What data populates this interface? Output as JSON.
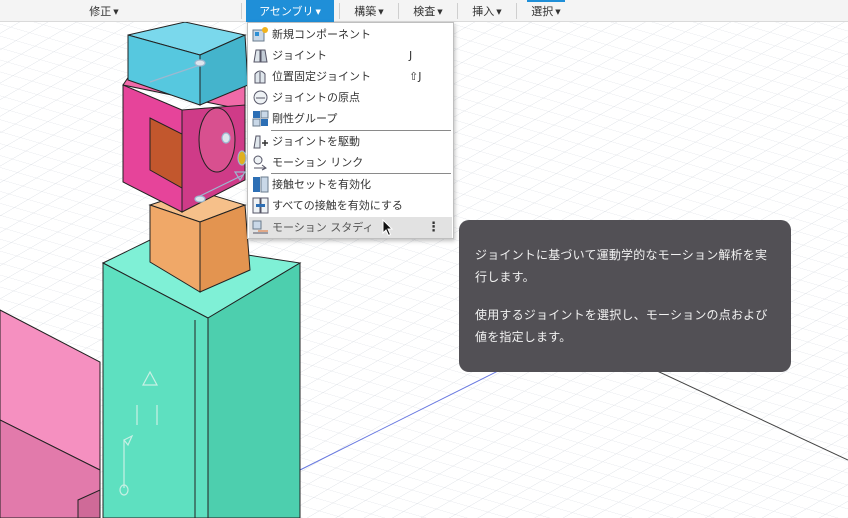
{
  "toolbar": {
    "items": [
      {
        "label": "修正",
        "active": false
      },
      {
        "label": "アセンブリ",
        "active": true
      },
      {
        "label": "構築",
        "active": false
      },
      {
        "label": "検査",
        "active": false
      },
      {
        "label": "挿入",
        "active": false
      },
      {
        "label": "選択",
        "active": false
      }
    ],
    "accent_color": "#1f8fd8"
  },
  "assemble_menu": {
    "items": [
      {
        "label": "新規コンポーネント",
        "shortcut": "",
        "icon": "new-component-icon"
      },
      {
        "label": "ジョイント",
        "shortcut": "J",
        "icon": "joint-icon"
      },
      {
        "label": "位置固定ジョイント",
        "shortcut": "⇧J",
        "icon": "as-built-joint-icon"
      },
      {
        "label": "ジョイントの原点",
        "shortcut": "",
        "icon": "joint-origin-icon"
      },
      {
        "label": "剛性グループ",
        "shortcut": "",
        "icon": "rigid-group-icon"
      },
      {
        "label": "ジョイントを駆動",
        "shortcut": "",
        "icon": "drive-joints-icon"
      },
      {
        "label": "モーション リンク",
        "shortcut": "",
        "icon": "motion-link-icon"
      },
      {
        "label": "接触セットを有効化",
        "shortcut": "",
        "icon": "enable-contact-sets-icon"
      },
      {
        "label": "すべての接触を有効にする",
        "shortcut": "",
        "icon": "enable-all-contact-icon"
      },
      {
        "label": "モーション スタディ",
        "shortcut": "",
        "icon": "motion-study-icon",
        "highlighted": true,
        "more": "⋮"
      }
    ]
  },
  "tooltip": {
    "paragraph1": "ジョイントに基づいて運動学的なモーション解析を実行します。",
    "paragraph2": "使用するジョイントを選択し、モーションの点および値を指定します。"
  },
  "colors": {
    "tooltip_bg": "#525055",
    "teal": "#5ee0c0",
    "cyan": "#56c8df",
    "magenta": "#e6449a",
    "orange": "#f0a868",
    "pink": "#f590c0"
  }
}
